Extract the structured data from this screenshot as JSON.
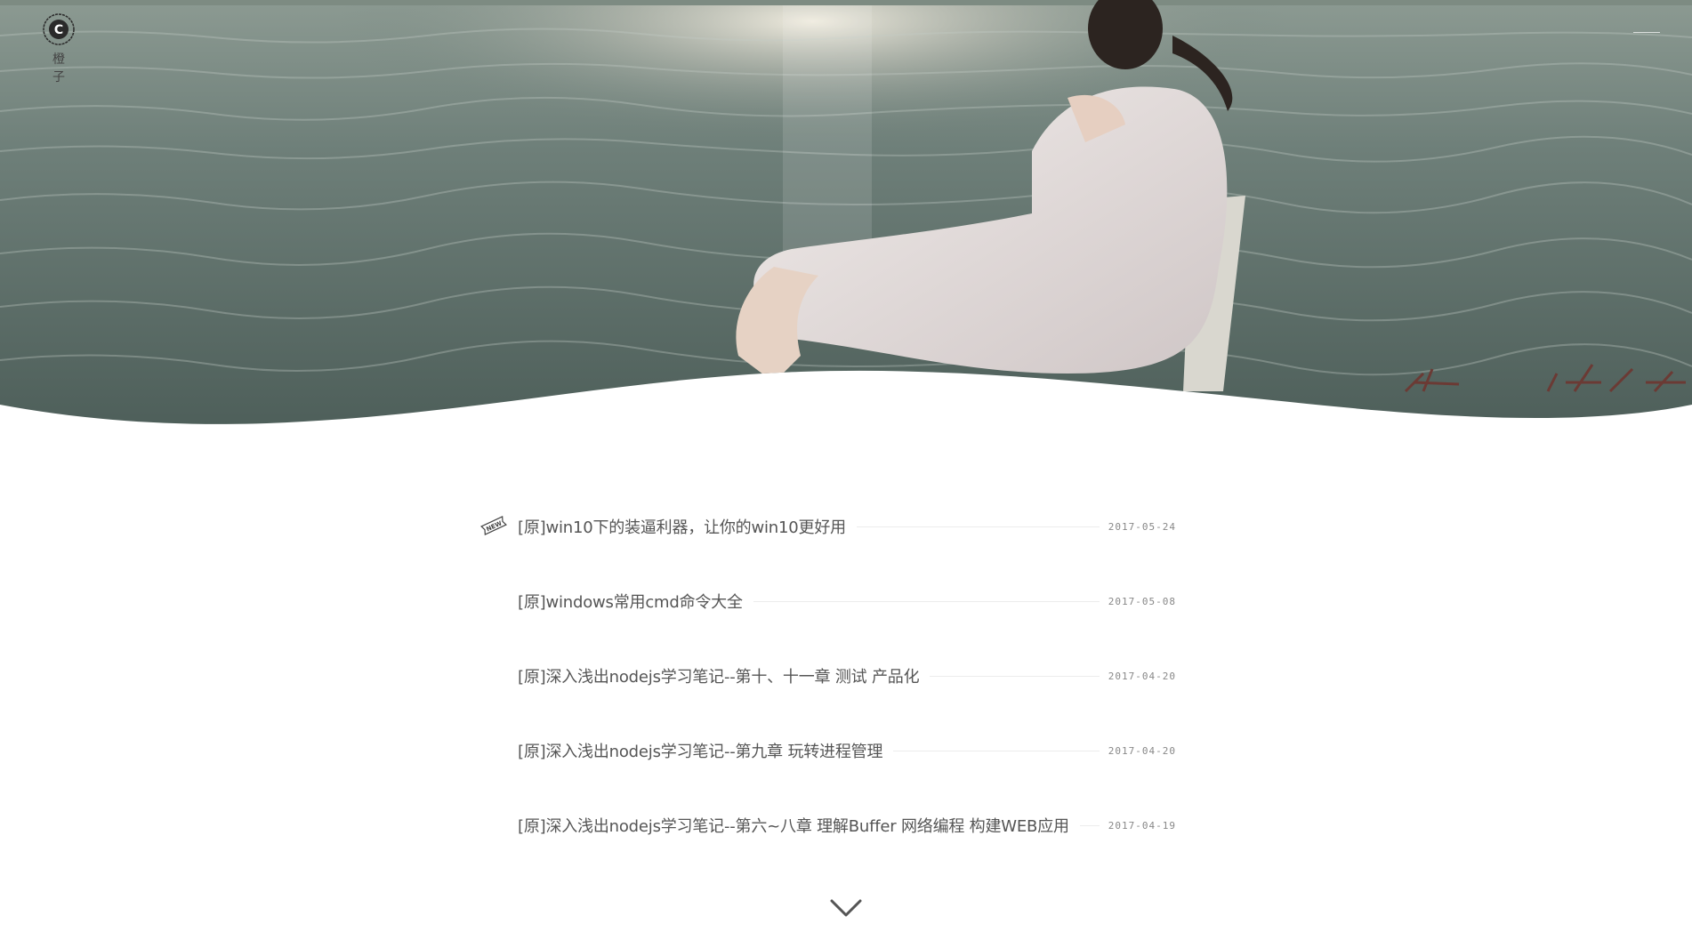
{
  "brand": {
    "name": "橙 子",
    "logo_letter": "C"
  },
  "posts": [
    {
      "title": "[原]win10下的装逼利器，让你的win10更好用",
      "date": "2017-05-24",
      "is_new": true
    },
    {
      "title": "[原]windows常用cmd命令大全",
      "date": "2017-05-08",
      "is_new": false
    },
    {
      "title": "[原]深入浅出nodejs学习笔记--第十、十一章 测试 产品化",
      "date": "2017-04-20",
      "is_new": false
    },
    {
      "title": "[原]深入浅出nodejs学习笔记--第九章 玩转进程管理",
      "date": "2017-04-20",
      "is_new": false
    },
    {
      "title": "[原]深入浅出nodejs学习笔记--第六~八章 理解Buffer 网络编程 构建WEB应用",
      "date": "2017-04-19",
      "is_new": false
    }
  ],
  "badge": {
    "text": "NEW"
  },
  "icons": {
    "logo": "c-circle-logo-icon",
    "menu": "hamburger-menu-icon",
    "new": "new-ribbon-icon",
    "more": "chevron-down-icon"
  },
  "colors": {
    "title_text": "#555555",
    "date_text": "#888888",
    "divider": "#ececec",
    "arrow": "#555555"
  }
}
